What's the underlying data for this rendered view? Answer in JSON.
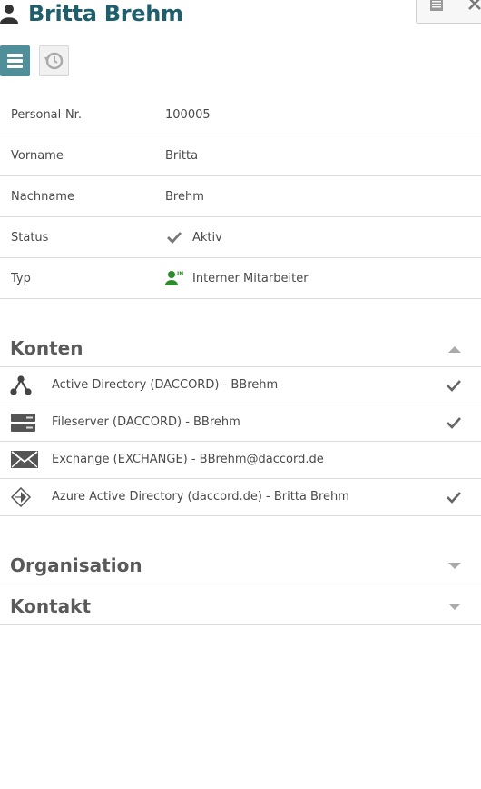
{
  "header": {
    "title": "Britta Brehm",
    "title_color": "#1f5f6b"
  },
  "fields": [
    {
      "label": "Personal-Nr.",
      "value": "100005"
    },
    {
      "label": "Vorname",
      "value": "Britta"
    },
    {
      "label": "Nachname",
      "value": "Brehm"
    },
    {
      "label": "Status",
      "value": "Aktiv",
      "icon": "checkmark-icon"
    },
    {
      "label": "Typ",
      "value": "Interner Mitarbeiter",
      "icon": "internal-employee-icon"
    }
  ],
  "sections": {
    "konten": {
      "title": "Konten",
      "expanded": true,
      "accounts": [
        {
          "label": "Active Directory (DACCORD) - BBrehm",
          "icon": "directory-tree-icon",
          "checked": true
        },
        {
          "label": "Fileserver (DACCORD) - BBrehm",
          "icon": "server-icon",
          "checked": true
        },
        {
          "label": "Exchange (EXCHANGE) - BBrehm@daccord.de",
          "icon": "envelope-icon",
          "checked": false
        },
        {
          "label": "Azure Active Directory (daccord.de) - Britta Brehm",
          "icon": "azure-icon",
          "checked": true
        }
      ]
    },
    "organisation": {
      "title": "Organisation",
      "expanded": false
    },
    "kontakt": {
      "title": "Kontakt",
      "expanded": false
    }
  },
  "colors": {
    "accent": "#4e8f9a",
    "employee_icon": "#2e8b2e",
    "divider": "#dcdcdc"
  }
}
